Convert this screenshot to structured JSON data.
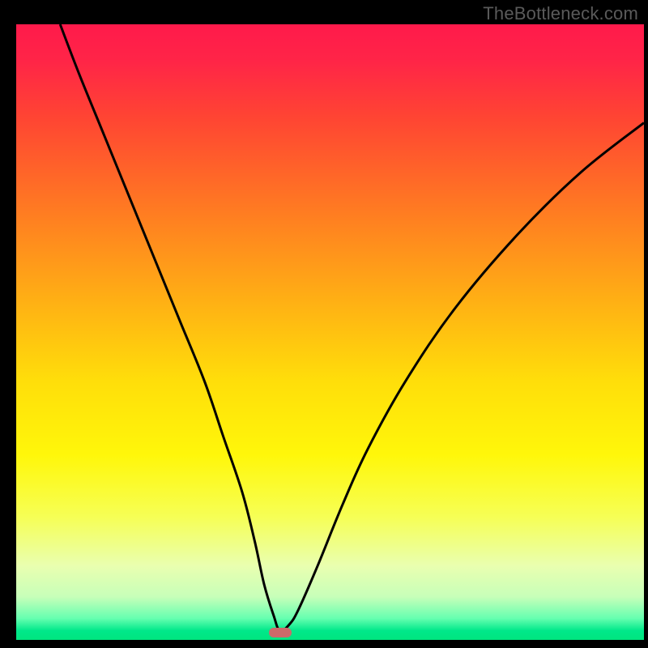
{
  "attribution": "TheBottleneck.com",
  "colors": {
    "frame": "#000000",
    "marker": "#cc6a6a",
    "curve": "#000000",
    "gradient_stops": [
      {
        "offset": 0.0,
        "color": "#ff1a4b"
      },
      {
        "offset": 0.06,
        "color": "#ff2547"
      },
      {
        "offset": 0.15,
        "color": "#ff4433"
      },
      {
        "offset": 0.3,
        "color": "#ff7a22"
      },
      {
        "offset": 0.45,
        "color": "#ffb014"
      },
      {
        "offset": 0.58,
        "color": "#ffde0a"
      },
      {
        "offset": 0.7,
        "color": "#fff70a"
      },
      {
        "offset": 0.8,
        "color": "#f6ff55"
      },
      {
        "offset": 0.88,
        "color": "#e9ffb0"
      },
      {
        "offset": 0.93,
        "color": "#c7ffb9"
      },
      {
        "offset": 0.965,
        "color": "#66ffb0"
      },
      {
        "offset": 0.985,
        "color": "#00e88a"
      },
      {
        "offset": 1.0,
        "color": "#00e57f"
      }
    ]
  },
  "chart_data": {
    "type": "line",
    "title": "",
    "xlabel": "",
    "ylabel": "",
    "xlim": [
      0,
      100
    ],
    "ylim": [
      0,
      100
    ],
    "grid": false,
    "legend": false,
    "marker": {
      "x": 42,
      "y": 1.2
    },
    "series": [
      {
        "name": "bottleneck-curve",
        "x": [
          7,
          10,
          14,
          18,
          22,
          26,
          30,
          33,
          36,
          38,
          39.5,
          41,
          42,
          43.5,
          45,
          48,
          52,
          56,
          62,
          70,
          80,
          90,
          100
        ],
        "y": [
          100,
          92,
          82,
          72,
          62,
          52,
          42,
          33,
          24,
          16,
          9,
          4,
          1.5,
          2.5,
          5,
          12,
          22,
          31,
          42,
          54,
          66,
          76,
          84
        ]
      }
    ]
  }
}
